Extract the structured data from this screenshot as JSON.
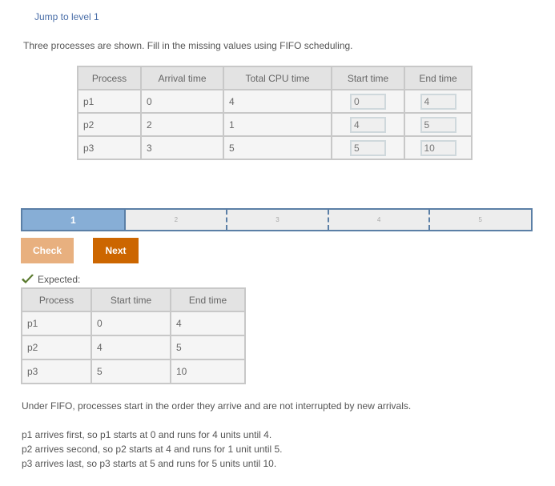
{
  "header": {
    "jump_link": "Jump to level 1"
  },
  "prompt": "Three processes are shown. Fill in the missing values using FIFO scheduling.",
  "problem_table": {
    "columns": [
      "Process",
      "Arrival time",
      "Total CPU time",
      "Start time",
      "End time"
    ],
    "rows": [
      {
        "process": "p1",
        "arrival": "0",
        "cpu": "4",
        "start": "0",
        "end": "4"
      },
      {
        "process": "p2",
        "arrival": "2",
        "cpu": "1",
        "start": "4",
        "end": "5"
      },
      {
        "process": "p3",
        "arrival": "3",
        "cpu": "5",
        "start": "5",
        "end": "10"
      }
    ]
  },
  "progress": {
    "levels": [
      "1",
      "2",
      "3",
      "4",
      "5"
    ],
    "current_level": 1
  },
  "buttons": {
    "check": "Check",
    "next": "Next"
  },
  "feedback": {
    "icon": "checkmark-icon",
    "label": "Expected:",
    "color": "#5a7a2e"
  },
  "expected_table": {
    "columns": [
      "Process",
      "Start time",
      "End time"
    ],
    "rows": [
      {
        "process": "p1",
        "start": "0",
        "end": "4"
      },
      {
        "process": "p2",
        "start": "4",
        "end": "5"
      },
      {
        "process": "p3",
        "start": "5",
        "end": "10"
      }
    ]
  },
  "explanation": {
    "intro": "Under FIFO, processes start in the order they arrive and are not interrupted by new arrivals.",
    "lines": [
      "p1 arrives first, so p1 starts at 0 and runs for 4 units until 4.",
      "p2 arrives second, so p2 starts at 4 and runs for 1 unit until 5.",
      "p3 arrives last, so p3 starts at 5 and runs for 5 units until 10."
    ]
  },
  "colors": {
    "link": "#4a6ea8",
    "progress_active": "#87aed6",
    "progress_border": "#5b7fa6",
    "check_button": "#e8b07f",
    "next_button": "#cc6600"
  }
}
